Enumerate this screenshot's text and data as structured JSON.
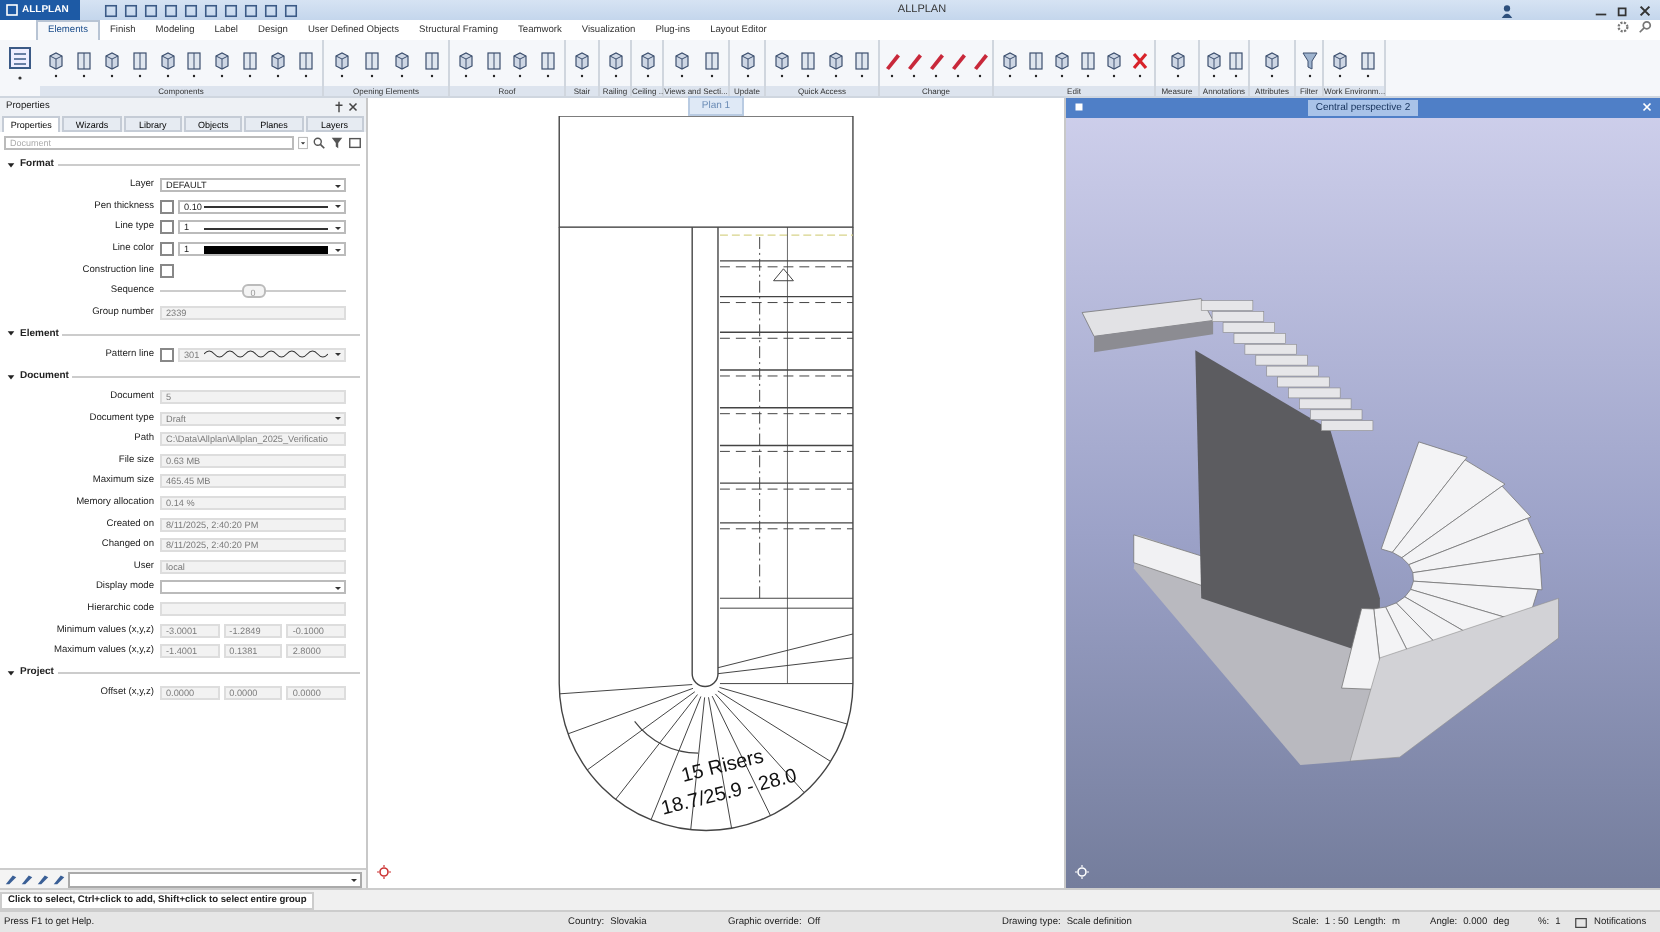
{
  "window": {
    "app_name": "ALLPLAN",
    "title": "ALLPLAN"
  },
  "ribbon_tabs": [
    {
      "label": "Elements",
      "selected": true
    },
    {
      "label": "Finish",
      "selected": false
    },
    {
      "label": "Modeling",
      "selected": false
    },
    {
      "label": "Label",
      "selected": false
    },
    {
      "label": "Design",
      "selected": false
    },
    {
      "label": "User Defined Objects",
      "selected": false
    },
    {
      "label": "Structural Framing",
      "selected": false
    },
    {
      "label": "Teamwork",
      "selected": false
    },
    {
      "label": "Visualization",
      "selected": false
    },
    {
      "label": "Plug-ins",
      "selected": false
    },
    {
      "label": "Layout Editor",
      "selected": false
    }
  ],
  "ribbon_groups": [
    {
      "label": "Components"
    },
    {
      "label": "Opening Elements"
    },
    {
      "label": "Roof"
    },
    {
      "label": "Stair"
    },
    {
      "label": "Railing"
    },
    {
      "label": "Ceiling ..."
    },
    {
      "label": "Views and Secti..."
    },
    {
      "label": "Update"
    },
    {
      "label": "Quick Access"
    },
    {
      "label": "Change"
    },
    {
      "label": "Edit"
    },
    {
      "label": "Measure"
    },
    {
      "label": "Annotations"
    },
    {
      "label": "Attributes"
    },
    {
      "label": "Filter"
    },
    {
      "label": "Work Environm..."
    }
  ],
  "properties_panel": {
    "title": "Properties",
    "tabs": [
      {
        "label": "Properties",
        "selected": true
      },
      {
        "label": "Wizards",
        "selected": false
      },
      {
        "label": "Library",
        "selected": false
      },
      {
        "label": "Objects",
        "selected": false
      },
      {
        "label": "Planes",
        "selected": false
      },
      {
        "label": "Layers",
        "selected": false
      }
    ],
    "search": {
      "placeholder": "Document"
    },
    "sections": [
      {
        "title": "Format",
        "expanded": true,
        "rows": [
          {
            "kind": "dropdown",
            "label": "Layer",
            "value": "DEFAULT",
            "disabled": false
          },
          {
            "kind": "line",
            "label": "Pen thickness",
            "checked": false,
            "value": "0.10",
            "disabled": false
          },
          {
            "kind": "line",
            "label": "Line type",
            "checked": false,
            "value": "1",
            "disabled": false
          },
          {
            "kind": "color",
            "label": "Line color",
            "checked": false,
            "value": "1",
            "disabled": false
          },
          {
            "kind": "checkbox",
            "label": "Construction line",
            "checked": false
          },
          {
            "kind": "slider",
            "label": "Sequence",
            "value": "0",
            "level": 0.5
          },
          {
            "kind": "text",
            "label": "Group number",
            "value": "2339",
            "disabled": true
          }
        ]
      },
      {
        "title": "Element",
        "expanded": true,
        "rows": [
          {
            "kind": "pattern",
            "label": "Pattern line",
            "checked": false,
            "value": "301",
            "disabled": true
          }
        ]
      },
      {
        "title": "Document",
        "expanded": true,
        "rows": [
          {
            "kind": "text",
            "label": "Document",
            "value": "5",
            "disabled": true
          },
          {
            "kind": "dropdown",
            "label": "Document type",
            "value": "Draft",
            "disabled": true
          },
          {
            "kind": "text",
            "label": "Path",
            "value": "C:\\Data\\Allplan\\Allplan_2025_Verificatio",
            "disabled": true
          },
          {
            "kind": "text",
            "label": "File size",
            "value": "0.63 MB",
            "disabled": true
          },
          {
            "kind": "text",
            "label": "Maximum size",
            "value": "465.45 MB",
            "disabled": true
          },
          {
            "kind": "text",
            "label": "Memory allocation",
            "value": "0.14 %",
            "disabled": true
          },
          {
            "kind": "text",
            "label": "Created on",
            "value": "8/11/2025, 2:40:20 PM",
            "disabled": true
          },
          {
            "kind": "text",
            "label": "Changed on",
            "value": "8/11/2025, 2:40:20 PM",
            "disabled": true
          },
          {
            "kind": "text",
            "label": "User",
            "value": "local",
            "disabled": true
          },
          {
            "kind": "dropdown",
            "label": "Display mode",
            "disabled": false
          },
          {
            "kind": "text",
            "label": "Hierarchic code",
            "disabled": true
          },
          {
            "kind": "triple",
            "label": "Minimum values (x,y,z)",
            "values": [
              "-3.0001",
              "-1.2849",
              "-0.1000"
            ],
            "disabled": true
          },
          {
            "kind": "triple",
            "label": "Maximum values (x,y,z)",
            "values": [
              "-1.4001",
              "0.1381",
              "2.8000"
            ],
            "disabled": true
          }
        ]
      },
      {
        "title": "Project",
        "expanded": true,
        "rows": [
          {
            "kind": "triple",
            "label": "Offset (x,y,z)",
            "values": [
              "0.0000",
              "0.0000",
              "0.0000"
            ],
            "disabled": true
          }
        ]
      }
    ]
  },
  "plan_view": {
    "title": "Plan 1",
    "risers_label": "15 Risers",
    "dimension_label": "18.7/25.9 - 28.0"
  },
  "perspective_view": {
    "title": "Central perspective 2"
  },
  "prompt": "Click to select, Ctrl+click to add, Shift+click to select entire group",
  "status_bar": [
    {
      "label": "Press F1 to get Help."
    },
    {
      "label": "Country:",
      "value": "Slovakia"
    },
    {
      "label": "Graphic override:",
      "value": "Off"
    },
    {
      "label": "Drawing type:",
      "value": "Scale definition"
    },
    {
      "label": "Scale:",
      "value": "1 : 50"
    },
    {
      "label": "Length:",
      "value": "m"
    },
    {
      "label": "Angle:",
      "value": "0.000",
      "unit": "deg"
    },
    {
      "label": "%:",
      "value": "1"
    },
    {
      "label": "Notifications",
      "kind": "notifications"
    }
  ]
}
